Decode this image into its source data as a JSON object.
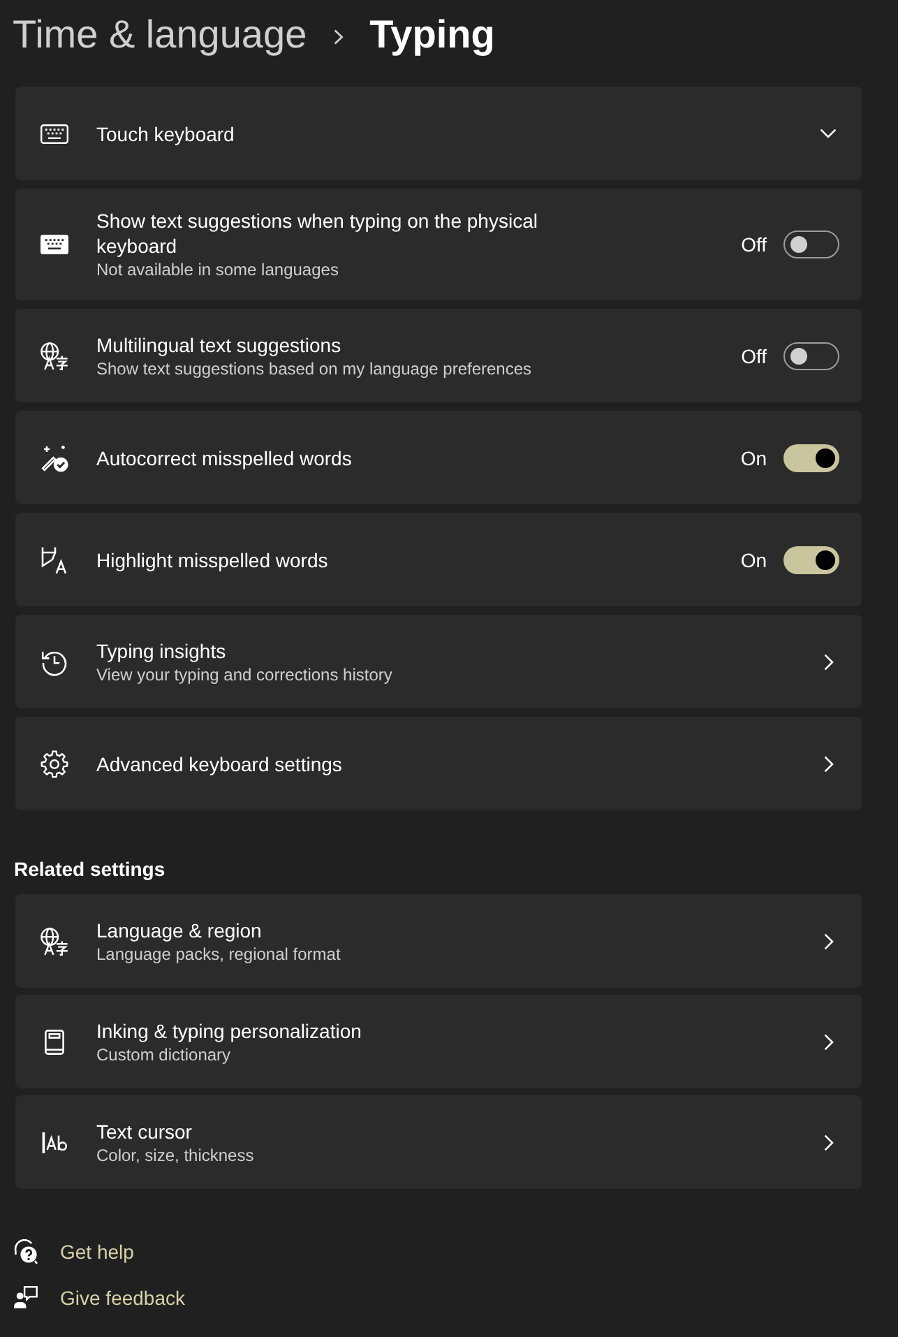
{
  "header": {
    "parent": "Time & language",
    "title": "Typing"
  },
  "settings": [
    {
      "kind": "expander",
      "title": "Touch keyboard",
      "expanded": false
    },
    {
      "kind": "toggle",
      "title": "Show text suggestions when typing on the physical keyboard",
      "subtitle": "Not available in some languages",
      "state_label": "Off",
      "on": false
    },
    {
      "kind": "toggle",
      "title": "Multilingual text suggestions",
      "subtitle": "Show text suggestions based on my language preferences",
      "state_label": "Off",
      "on": false
    },
    {
      "kind": "toggle",
      "title": "Autocorrect misspelled words",
      "state_label": "On",
      "on": true
    },
    {
      "kind": "toggle",
      "title": "Highlight misspelled words",
      "state_label": "On",
      "on": true
    },
    {
      "kind": "link",
      "title": "Typing insights",
      "subtitle": "View your typing and corrections history"
    },
    {
      "kind": "link",
      "title": "Advanced keyboard settings"
    }
  ],
  "related_settings": {
    "heading": "Related settings",
    "items": [
      {
        "kind": "link",
        "title": "Language & region",
        "subtitle": "Language packs, regional format"
      },
      {
        "kind": "link",
        "title": "Inking & typing personalization",
        "subtitle": "Custom dictionary"
      },
      {
        "kind": "link",
        "title": "Text cursor",
        "subtitle": "Color, size, thickness"
      }
    ]
  },
  "footer_links": [
    {
      "label": "Get help"
    },
    {
      "label": "Give feedback"
    }
  ]
}
